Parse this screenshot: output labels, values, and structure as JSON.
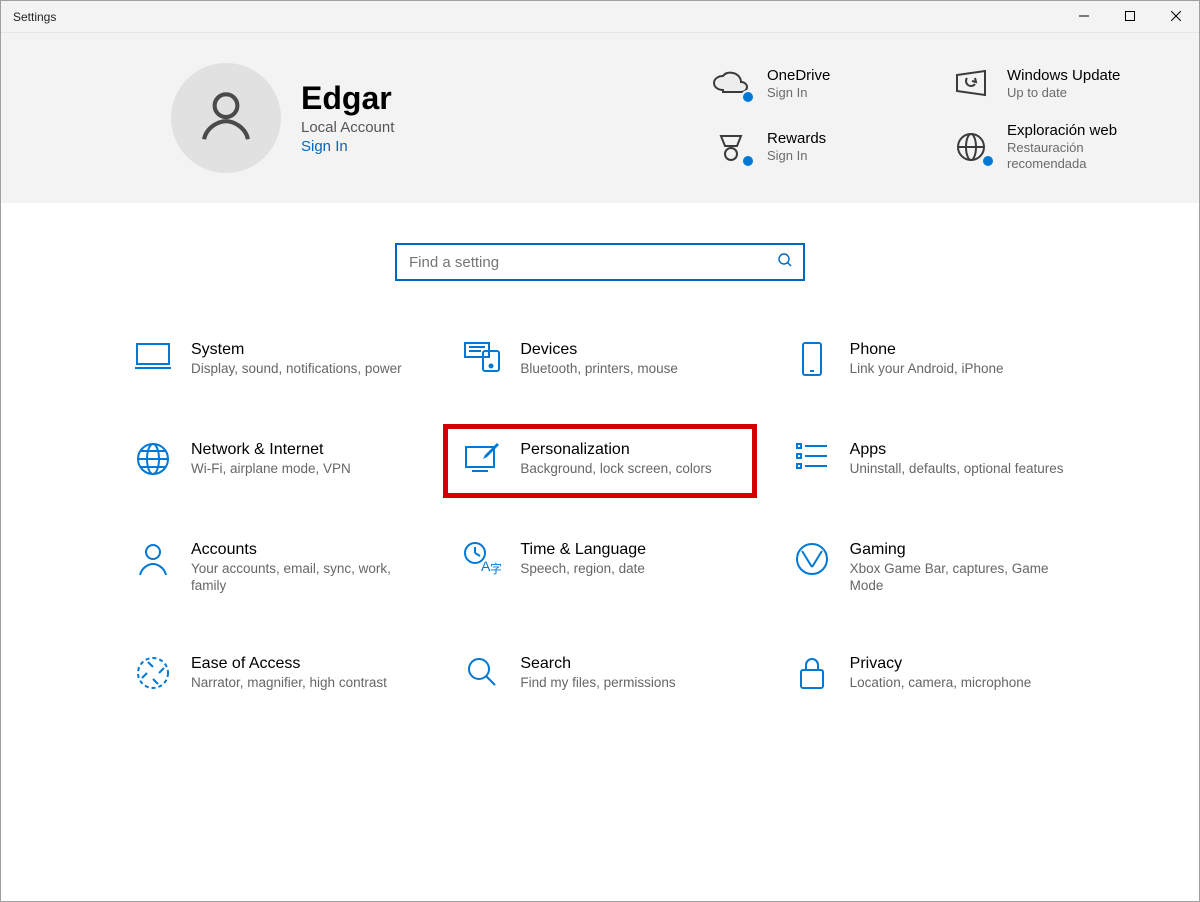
{
  "window": {
    "title": "Settings"
  },
  "header": {
    "user_name": "Edgar",
    "account_type": "Local Account",
    "sign_in_label": "Sign In",
    "statuses": {
      "onedrive": {
        "title": "OneDrive",
        "sub": "Sign In"
      },
      "windows_update": {
        "title": "Windows Update",
        "sub": "Up to date"
      },
      "rewards": {
        "title": "Rewards",
        "sub": "Sign In"
      },
      "web_browsing": {
        "title": "Exploración web",
        "sub": "Restauración recomendada"
      }
    }
  },
  "search": {
    "placeholder": "Find a setting"
  },
  "categories": {
    "system": {
      "title": "System",
      "sub": "Display, sound, notifications, power"
    },
    "devices": {
      "title": "Devices",
      "sub": "Bluetooth, printers, mouse"
    },
    "phone": {
      "title": "Phone",
      "sub": "Link your Android, iPhone"
    },
    "network": {
      "title": "Network & Internet",
      "sub": "Wi-Fi, airplane mode, VPN"
    },
    "personalization": {
      "title": "Personalization",
      "sub": "Background, lock screen, colors"
    },
    "apps": {
      "title": "Apps",
      "sub": "Uninstall, defaults, optional features"
    },
    "accounts": {
      "title": "Accounts",
      "sub": "Your accounts, email, sync, work, family"
    },
    "time_language": {
      "title": "Time & Language",
      "sub": "Speech, region, date"
    },
    "gaming": {
      "title": "Gaming",
      "sub": "Xbox Game Bar, captures, Game Mode"
    },
    "ease_of_access": {
      "title": "Ease of Access",
      "sub": "Narrator, magnifier, high contrast"
    },
    "search": {
      "title": "Search",
      "sub": "Find my files, permissions"
    },
    "privacy": {
      "title": "Privacy",
      "sub": "Location, camera, microphone"
    }
  },
  "colors": {
    "accent": "#0067c0",
    "icon": "#0078d4",
    "highlight": "#d40000"
  }
}
